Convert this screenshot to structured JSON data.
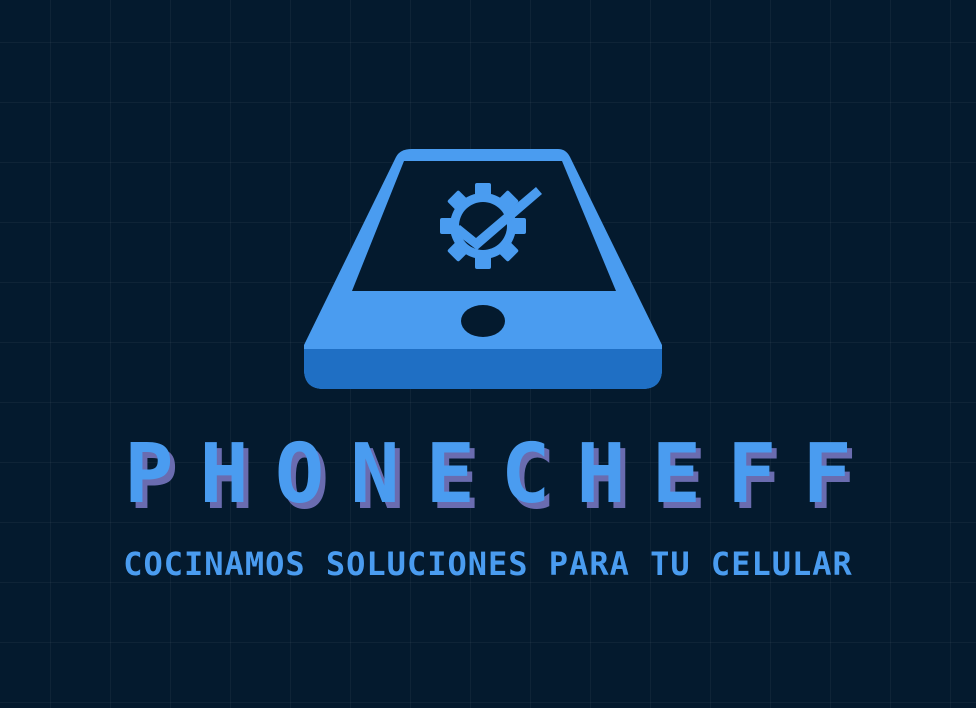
{
  "brand": {
    "name": "PHONECHEFF",
    "tagline": "COCINAMOS SOLUCIONES PARA TU CELULAR"
  },
  "icons": {
    "main": "phone-gear-check-icon",
    "gear": "gear-icon",
    "check": "check-icon",
    "home_button": "home-button-icon"
  },
  "colors": {
    "background": "#041a2e",
    "primary": "#4a9cf0",
    "primary_dark": "#1f6fc4",
    "shadow": "#6a6cb0"
  }
}
